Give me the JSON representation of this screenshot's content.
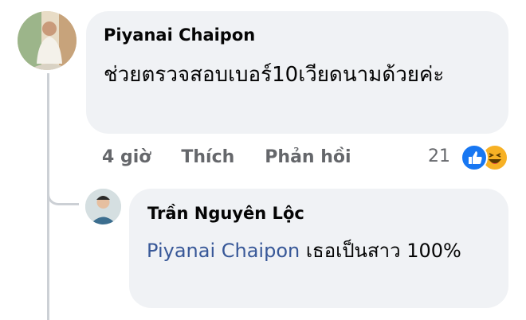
{
  "comment": {
    "author": "Piyanai Chaipon",
    "text": "ช่วยตรวจสอบเบอร์10เวียดนามด้วยค่ะ",
    "time": "4 giờ",
    "like_label": "Thích",
    "reply_label": "Phản hồi",
    "reaction_count": "21",
    "reactions": [
      "like-icon",
      "haha-icon"
    ]
  },
  "reply": {
    "author": "Trần Nguyên Lộc",
    "mention": "Piyanai Chaipon",
    "text": " เธอเป็นสาว 100%"
  },
  "colors": {
    "bubble": "#f0f2f5",
    "mention": "#385898",
    "meta": "#65676b",
    "like": "#1877f2",
    "haha": "#f7b125"
  }
}
